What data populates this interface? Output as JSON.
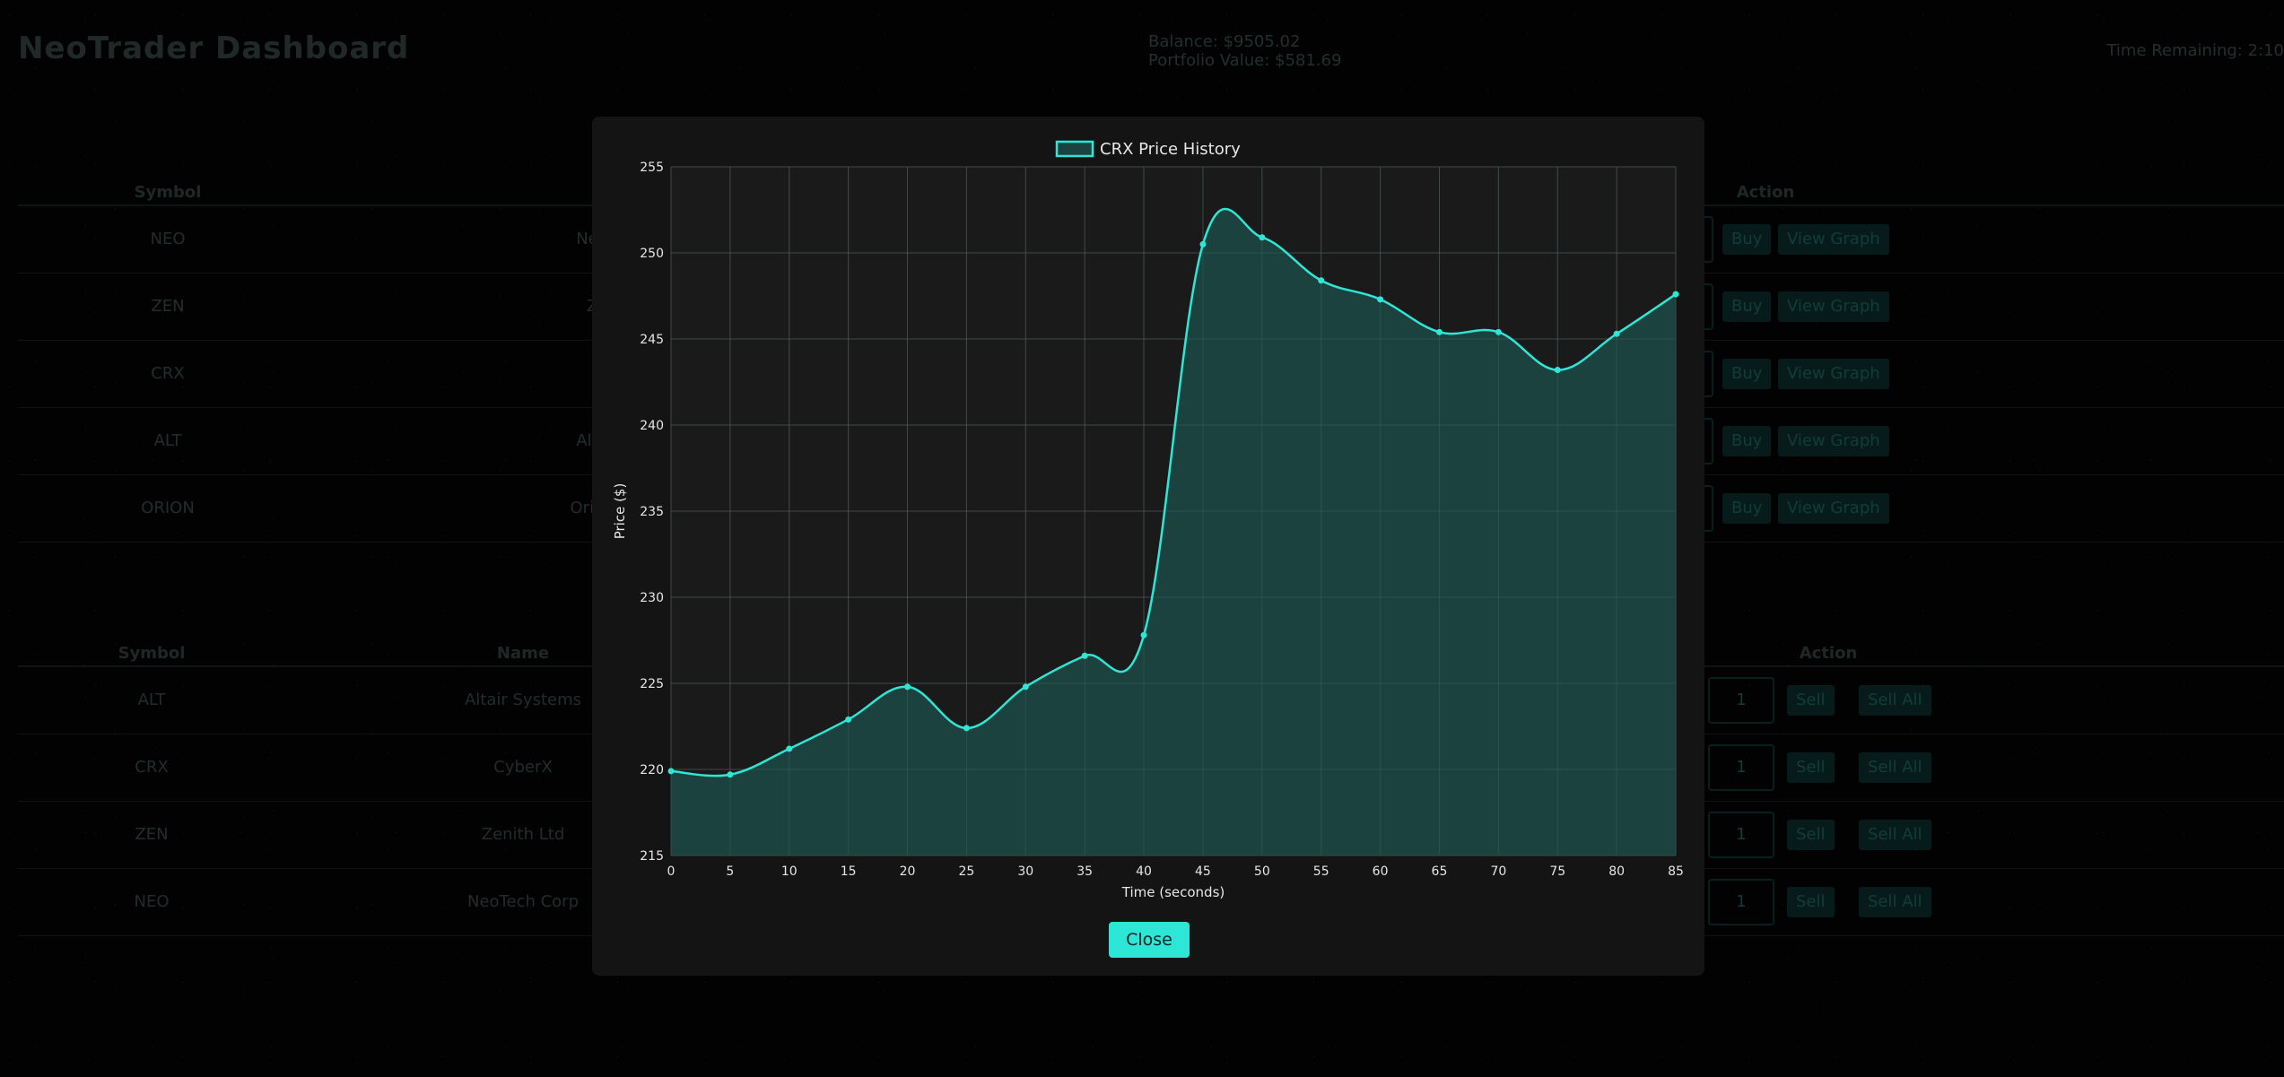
{
  "header": {
    "title": "NeoTrader Dashboard",
    "balance": "Balance: $9505.02",
    "portfolio": "Portfolio Value: $581.69",
    "time_remaining": "Time Remaining: 2:10"
  },
  "market": {
    "headers": {
      "symbol": "Symbol",
      "action": "Action"
    },
    "rows": [
      {
        "symbol": "NEO",
        "name_fragment": "Neo"
      },
      {
        "symbol": "ZEN",
        "name_fragment": "Z"
      },
      {
        "symbol": "CRX",
        "name_fragment": ""
      },
      {
        "symbol": "ALT",
        "name_fragment": "Alta"
      },
      {
        "symbol": "ORION",
        "name_fragment": "Orion"
      }
    ],
    "buy_label": "Buy",
    "view_graph_label": "View Graph"
  },
  "portfolio": {
    "headers": {
      "symbol": "Symbol",
      "name": "Name",
      "action": "Action"
    },
    "rows": [
      {
        "symbol": "ALT",
        "name": "Altair Systems",
        "qty": "1"
      },
      {
        "symbol": "CRX",
        "name": "CyberX",
        "qty": "1"
      },
      {
        "symbol": "ZEN",
        "name": "Zenith Ltd",
        "qty": "1"
      },
      {
        "symbol": "NEO",
        "name": "NeoTech Corp",
        "qty": "1"
      }
    ],
    "sell_label": "Sell",
    "sell_all_label": "Sell All"
  },
  "modal": {
    "close_label": "Close"
  },
  "colors": {
    "line": "#2ee6d6",
    "fill": "#1b4440",
    "grid": "#3a3a3a"
  },
  "chart_data": {
    "type": "area",
    "legend": "CRX Price History",
    "xlabel": "Time (seconds)",
    "ylabel": "Price ($)",
    "x": [
      0,
      5,
      10,
      15,
      20,
      25,
      30,
      35,
      40,
      45,
      50,
      55,
      60,
      65,
      70,
      75,
      80,
      85
    ],
    "y": [
      219.9,
      219.7,
      221.2,
      222.9,
      224.8,
      222.4,
      224.8,
      226.6,
      227.8,
      250.5,
      250.9,
      248.4,
      247.3,
      245.4,
      245.4,
      243.2,
      245.3,
      247.6
    ],
    "xlim": [
      0,
      85
    ],
    "ylim": [
      215,
      255
    ],
    "yticks": [
      "255",
      "250",
      "245",
      "240",
      "235",
      "230",
      "225",
      "220",
      "215"
    ],
    "grid": true,
    "legend_position": "top"
  }
}
